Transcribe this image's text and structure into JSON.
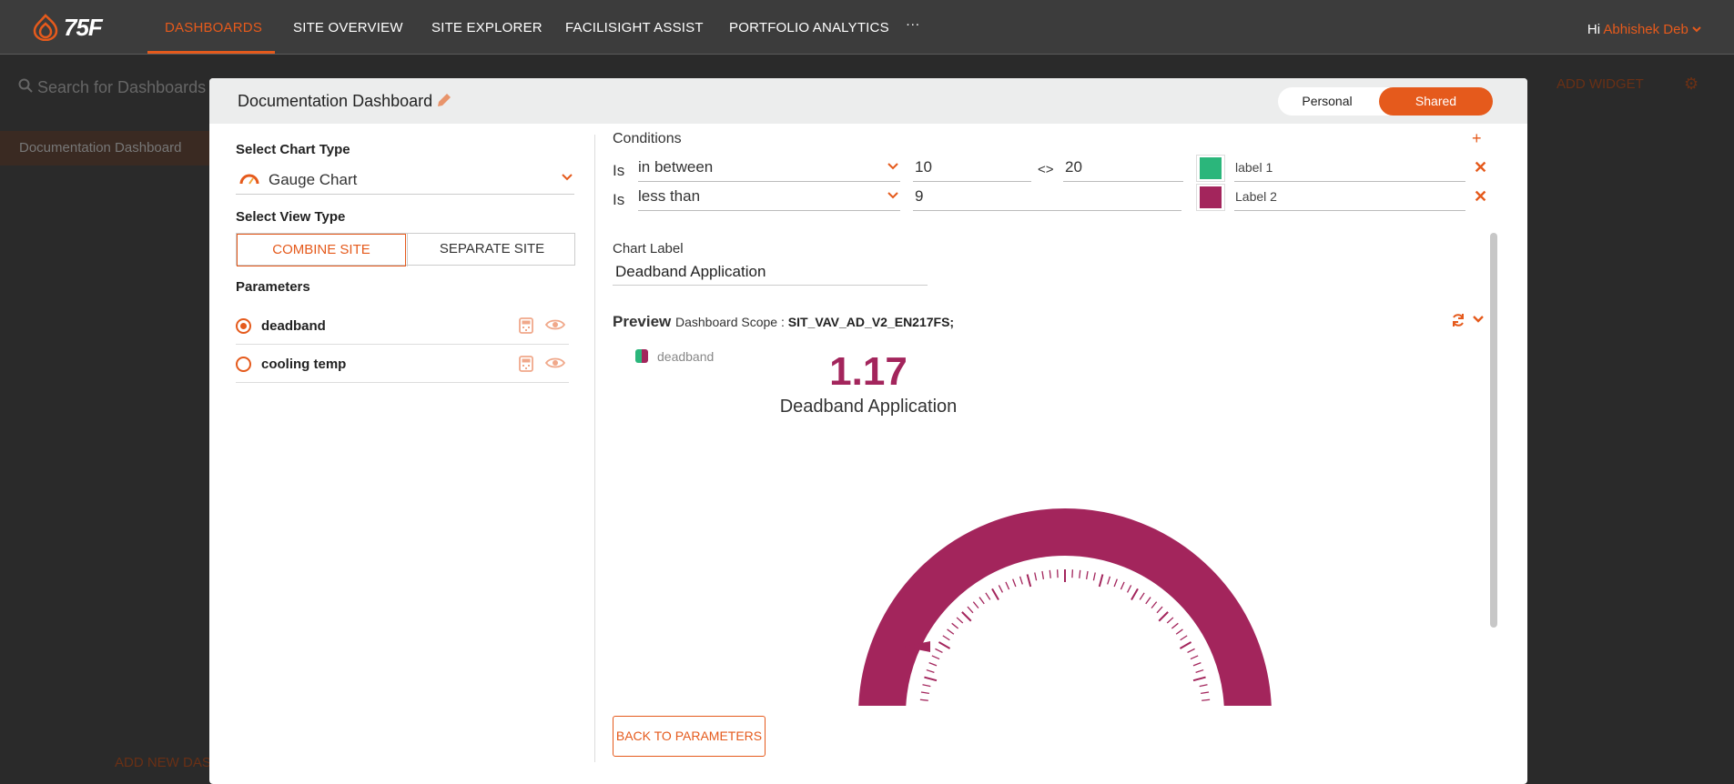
{
  "nav": {
    "logo_text": "75F",
    "items": [
      "DASHBOARDS",
      "SITE OVERVIEW",
      "SITE EXPLORER",
      "FACILISIGHT ASSIST",
      "PORTFOLIO ANALYTICS"
    ],
    "more": "···",
    "greet": "Hi",
    "user": "Abhishek Deb"
  },
  "background": {
    "search_placeholder": "Search for Dashboards",
    "dashboard_item": "Documentation Dashboard",
    "add_new": "ADD NEW DAS",
    "add_widget": "ADD WIDGET"
  },
  "modal": {
    "title": "Documentation Dashboard",
    "toggle": {
      "personal": "Personal",
      "shared": "Shared",
      "selected": "Shared"
    },
    "left": {
      "chart_type_label": "Select Chart Type",
      "chart_type_value": "Gauge Chart",
      "view_type_label": "Select View Type",
      "view_combine": "COMBINE SITE",
      "view_separate": "SEPARATE SITE",
      "parameters_label": "Parameters",
      "parameters": [
        {
          "name": "deadband",
          "selected": true
        },
        {
          "name": "cooling temp",
          "selected": false
        }
      ]
    },
    "right": {
      "conditions_label": "Conditions",
      "conditions": [
        {
          "is": "Is",
          "operator": "in between",
          "value1": "10",
          "sep": "<>",
          "value2": "20",
          "color": "#2bb67b",
          "label": "label 1"
        },
        {
          "is": "Is",
          "operator": "less than",
          "value1": "9",
          "color": "#a3255c",
          "label": "Label 2"
        }
      ],
      "chart_label_title": "Chart Label",
      "chart_label_value": "Deadband Application",
      "preview_title": "Preview",
      "scope_prefix": "Dashboard Scope :",
      "scope_value": "SIT_VAV_AD_V2_EN217FS;",
      "legend_label": "deadband",
      "gauge_value": "1.17",
      "gauge_label": "Deadband Application",
      "back_button": "BACK TO PARAMETERS"
    }
  },
  "colors": {
    "accent": "#e55a1c",
    "gauge": "#a3255c",
    "green": "#2bb67b"
  }
}
